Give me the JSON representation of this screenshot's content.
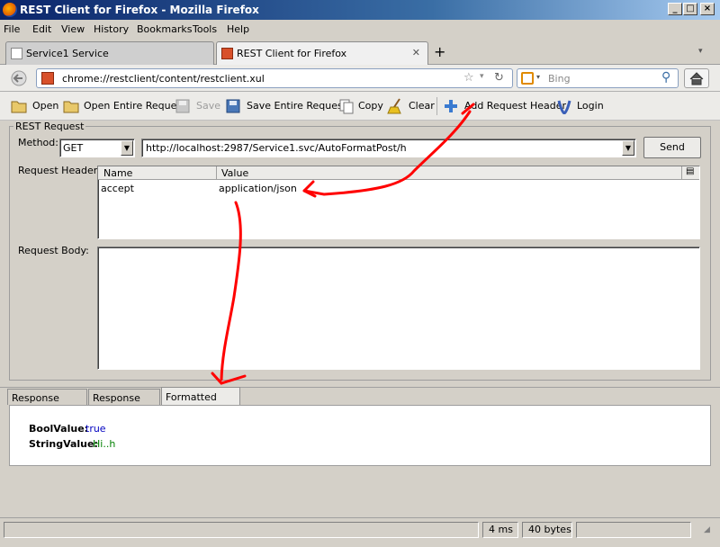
{
  "window": {
    "title": "REST Client for Firefox - Mozilla Firefox",
    "minimize": "_",
    "maximize": "□",
    "close": "×"
  },
  "menu": [
    "File",
    "Edit",
    "View",
    "History",
    "Bookmarks",
    "Tools",
    "Help"
  ],
  "tabs": [
    {
      "label": "Service1 Service",
      "active": false
    },
    {
      "label": "REST Client for Firefox",
      "active": true
    }
  ],
  "new_tab": "+",
  "nav": {
    "url": "chrome://restclient/content/restclient.xul",
    "search_placeholder": "Bing"
  },
  "toolbar": {
    "open": "Open",
    "open_entire": "Open Entire Request",
    "save": "Save",
    "save_entire": "Save Entire Request",
    "copy": "Copy",
    "clear": "Clear",
    "add_header": "Add Request Header",
    "login": "Login"
  },
  "request": {
    "group_title": "REST Request",
    "method_label": "Method:",
    "method_value": "GET",
    "url_value": "http://localhost:2987/Service1.svc/AutoFormatPost/h",
    "send": "Send",
    "header_label": "Request Header:",
    "header_columns": [
      "Name",
      "Value"
    ],
    "headers": [
      {
        "name": "accept",
        "value": "application/json"
      }
    ],
    "body_label": "Request Body:"
  },
  "response": {
    "tabs": [
      "Response Header",
      "Response Body",
      "Formatted JSON"
    ],
    "active_tab": "Formatted JSON",
    "json": [
      {
        "key": "BoolValue:",
        "value": "true"
      },
      {
        "key": "StringValue:",
        "value": "Hi..h"
      }
    ]
  },
  "status": {
    "time": "4 ms",
    "size": "40 bytes"
  },
  "colors": {
    "annotation": "#ff0000",
    "json_bool": "#0000c0",
    "json_string": "#008000"
  }
}
